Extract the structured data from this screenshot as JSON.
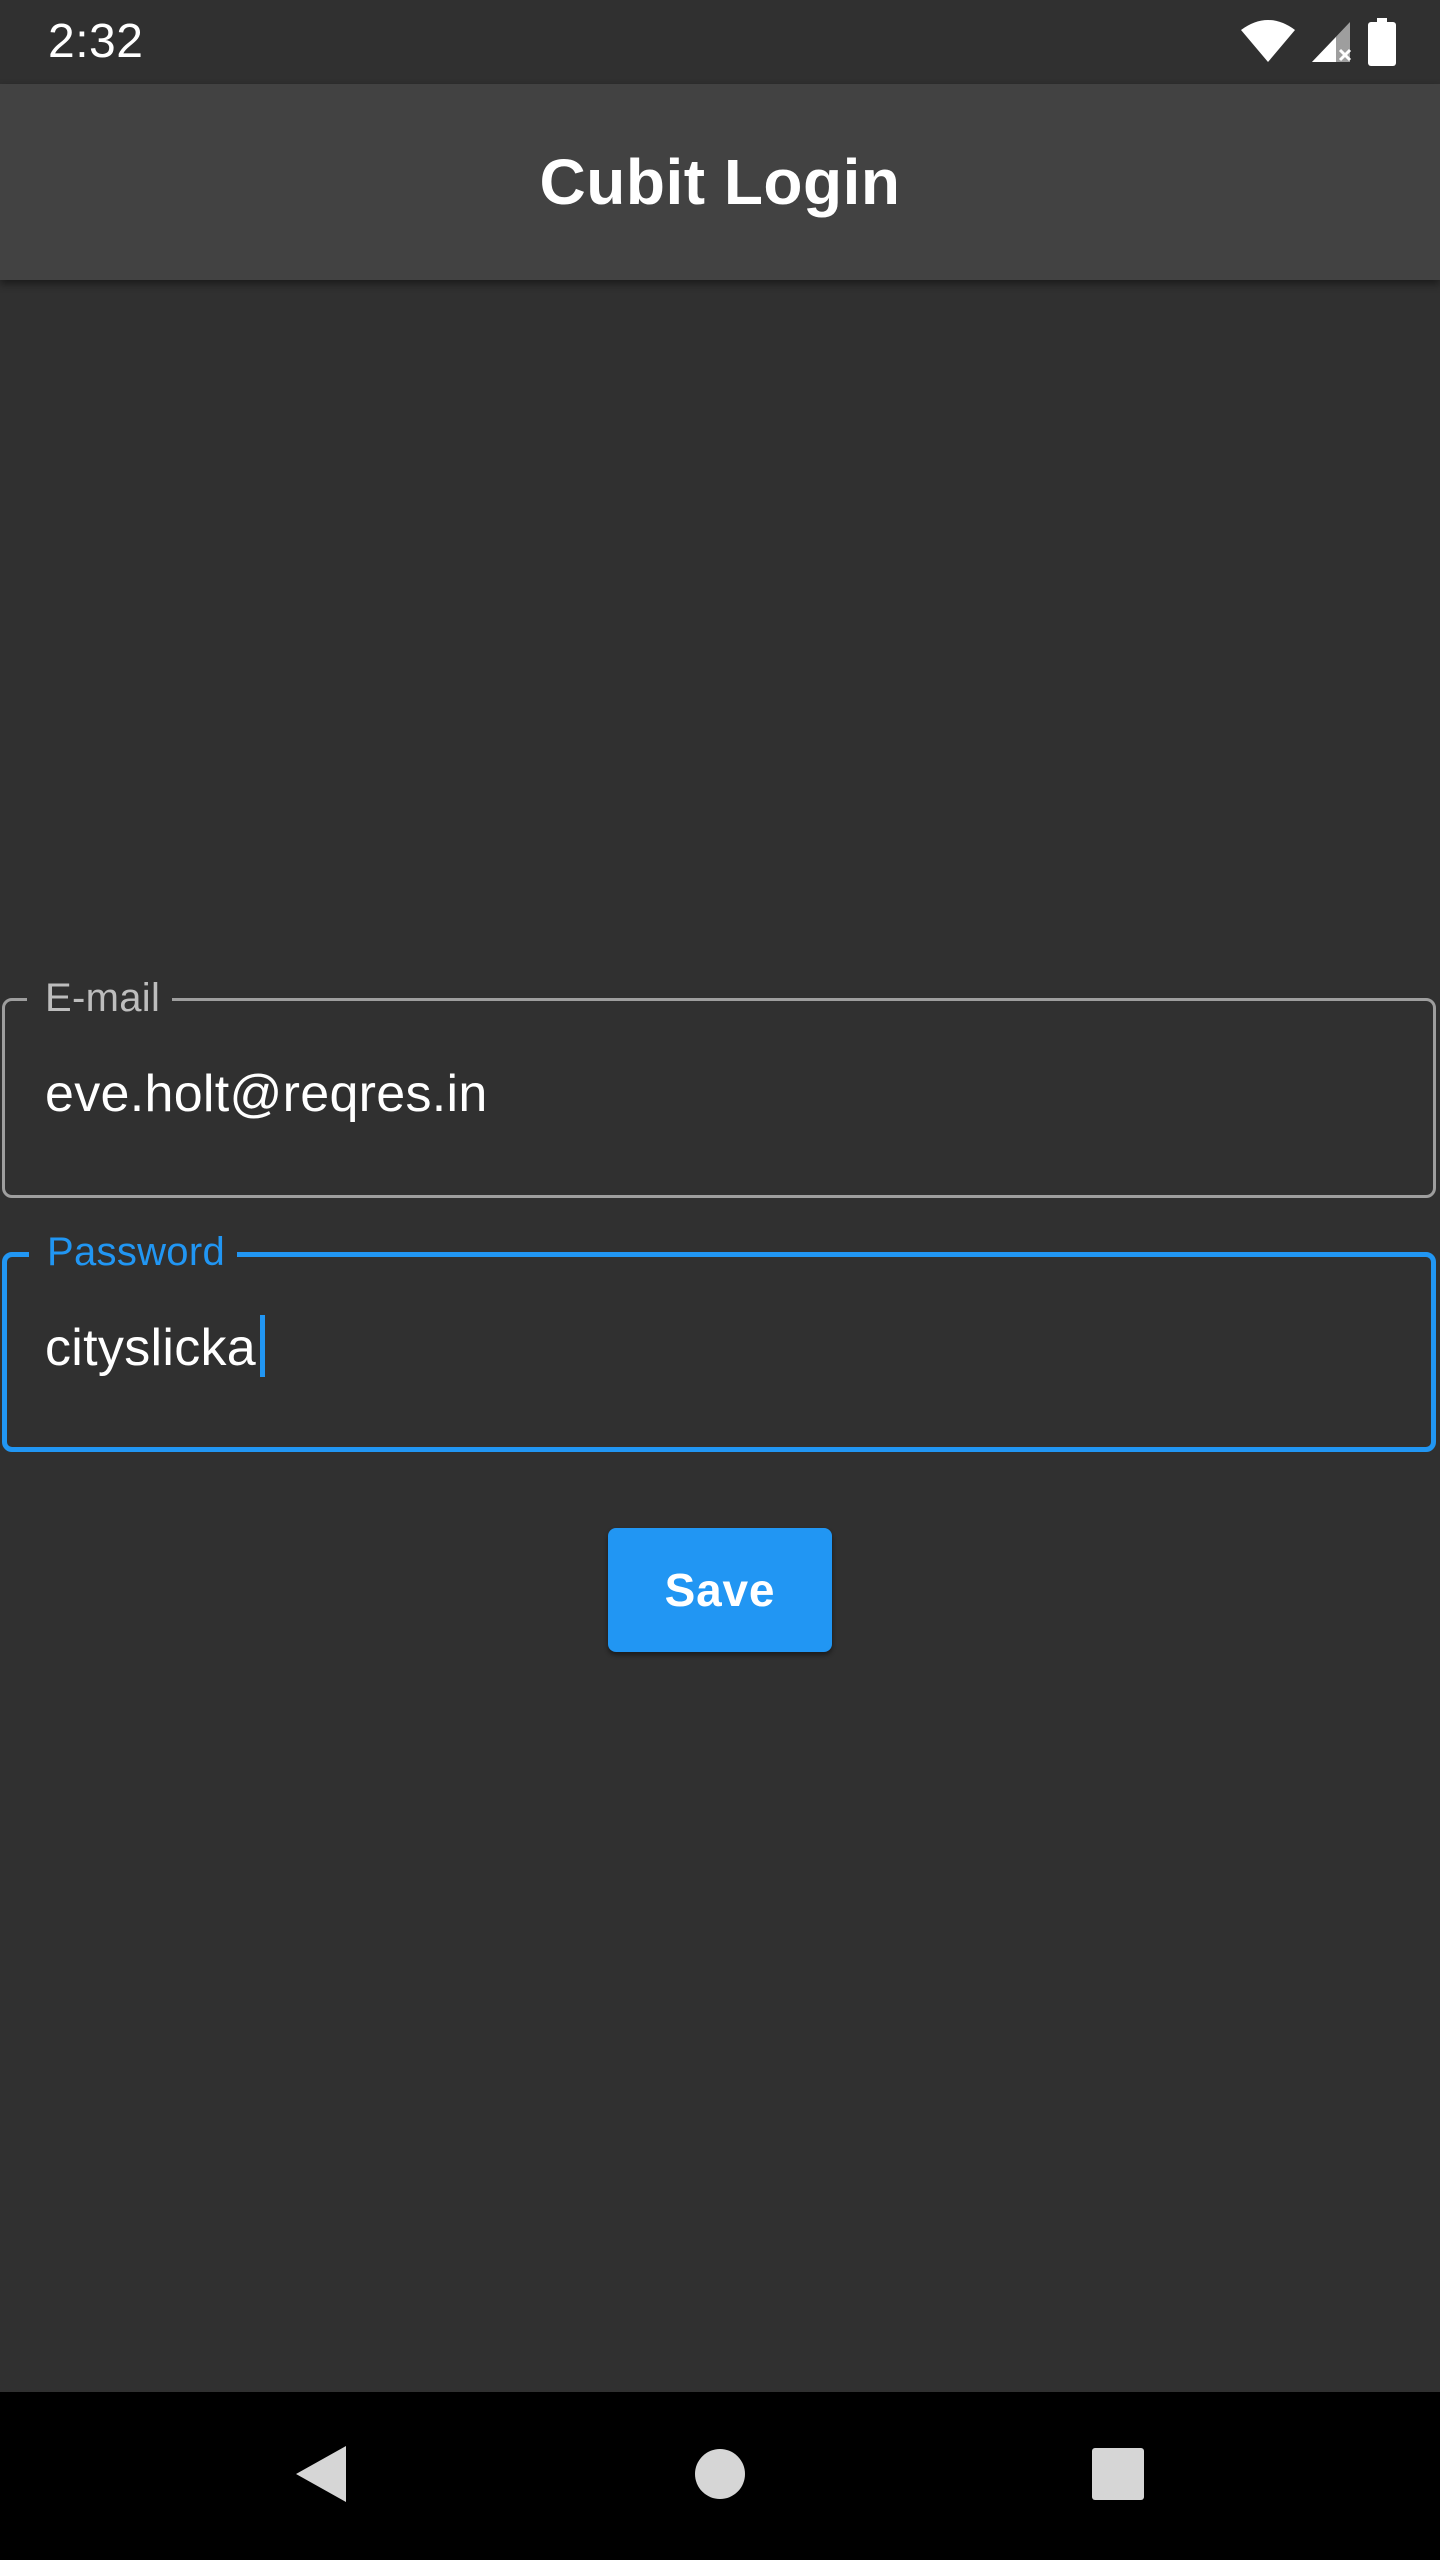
{
  "status_bar": {
    "time": "2:32",
    "icons": [
      "wifi-icon",
      "cell-signal-icon",
      "battery-icon"
    ]
  },
  "app_bar": {
    "title": "Cubit Login"
  },
  "form": {
    "email": {
      "label": "E-mail",
      "value": "eve.holt@reqres.in",
      "focused": false
    },
    "password": {
      "label": "Password",
      "value": "cityslicka",
      "focused": true
    },
    "save_label": "Save"
  },
  "nav_bar": {
    "icons": [
      "back-icon",
      "home-icon",
      "recents-icon"
    ]
  },
  "colors": {
    "background": "#303030",
    "app_bar": "#424242",
    "accent": "#2196f3",
    "outline_inactive": "#9e9e9e",
    "text_primary": "#ffffff"
  }
}
